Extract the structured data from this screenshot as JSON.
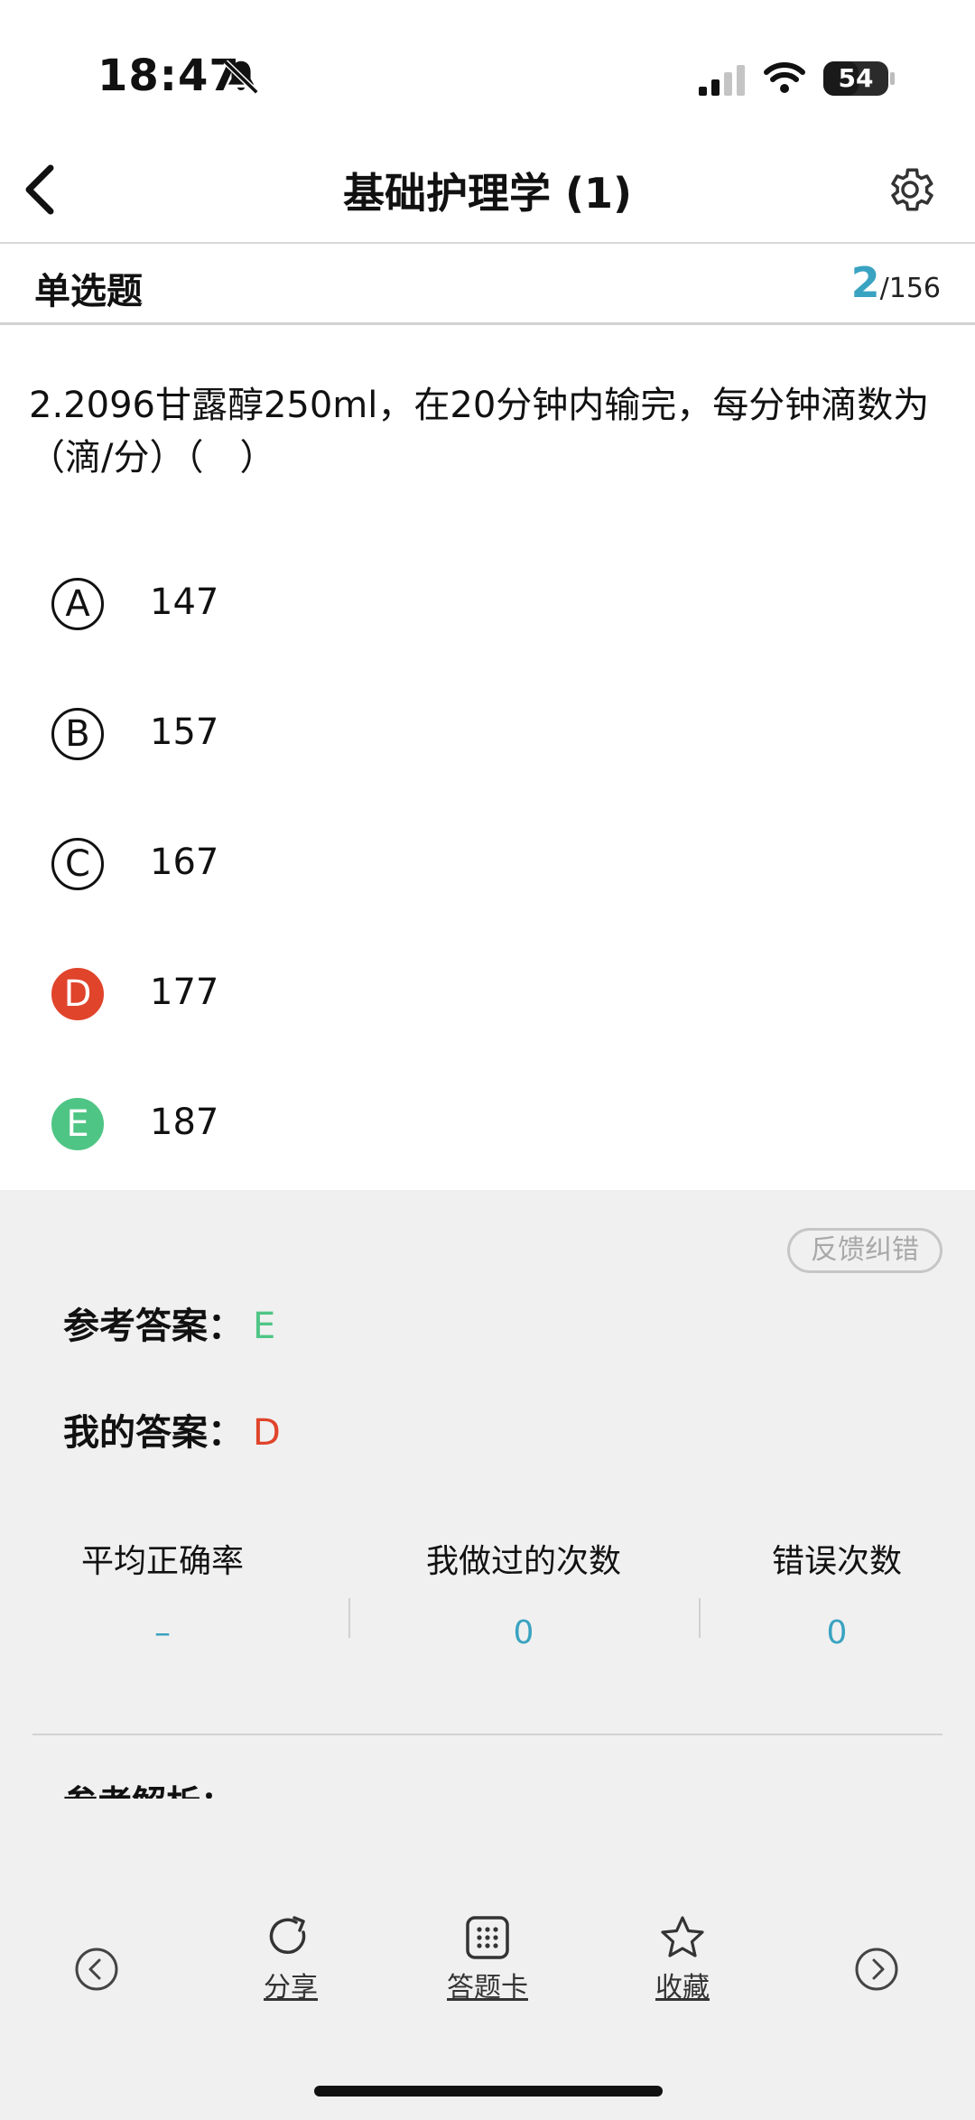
{
  "status_bar": {
    "time": "18:47",
    "battery": "54",
    "battery_level": 0.54,
    "icons": [
      "bell-slash-icon",
      "cellular-signal-icon",
      "wifi-icon",
      "battery-icon"
    ]
  },
  "nav": {
    "title": "基础护理学 (1)",
    "icons": [
      "chevron-left-icon",
      "gear-icon"
    ]
  },
  "question_header": {
    "type_label": "单选题",
    "current": "2",
    "total": "/156"
  },
  "question": {
    "text": "2.2096甘露醇250ml，在20分钟内输完，每分钟滴数为（滴/分）（　）",
    "options": [
      {
        "letter": "A",
        "value": "147",
        "state": "default"
      },
      {
        "letter": "B",
        "value": "157",
        "state": "default"
      },
      {
        "letter": "C",
        "value": "167",
        "state": "default"
      },
      {
        "letter": "D",
        "value": "177",
        "state": "wrong"
      },
      {
        "letter": "E",
        "value": "187",
        "state": "correct"
      }
    ]
  },
  "answer_panel": {
    "feedback_label": "反馈纠错",
    "reference_label": "参考答案：",
    "reference_value": "E",
    "my_label": "我的答案：",
    "my_value": "D",
    "stats": [
      {
        "label": "平均正确率",
        "value": "–"
      },
      {
        "label": "我做过的次数",
        "value": "0"
      },
      {
        "label": "错误次数",
        "value": "0"
      }
    ],
    "analysis_label": "参考解析："
  },
  "toolbar": {
    "share_label": "分享",
    "card_label": "答题卡",
    "favorite_label": "收藏",
    "icons": [
      "circle-arrow-left-icon",
      "share-icon",
      "grid-icon",
      "star-icon",
      "circle-arrow-right-icon"
    ]
  },
  "colors": {
    "accent": "#3aa3c1",
    "correct": "#4fc585",
    "wrong": "#e0442b",
    "panel_bg": "#f0f0f0"
  }
}
